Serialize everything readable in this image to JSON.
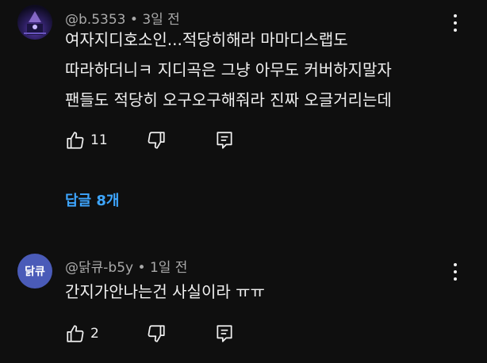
{
  "comments": [
    {
      "author": "@b.5353",
      "separator": "•",
      "time": "3일 전",
      "lines": [
        "여자지디호소인...적당히해라 마마디스랩도",
        "따라하더니ㅋ 지디곡은 그냥 아무도 커버하지말자",
        "팬들도 적당히 오구오구해줘라 진짜 오글거리는데"
      ],
      "likes": "11",
      "replies": "답글 8개"
    },
    {
      "author": "@닭큐-b5y",
      "separator": "•",
      "time": "1일 전",
      "avatar_text": "닭큐",
      "lines": [
        "간지가안나는건 사실이라 ㅠㅠ"
      ],
      "likes": "2"
    }
  ],
  "icons": {
    "like": "thumbs-up-icon",
    "dislike": "thumbs-down-icon",
    "reply": "reply-comment-icon",
    "menu": "more-vert-icon"
  },
  "colors": {
    "background": "#0f0f0f",
    "text": "#f1f1f1",
    "meta": "#aaaaaa",
    "link": "#3ea6ff",
    "avatar_letter_bg": "#4a5bb8"
  }
}
